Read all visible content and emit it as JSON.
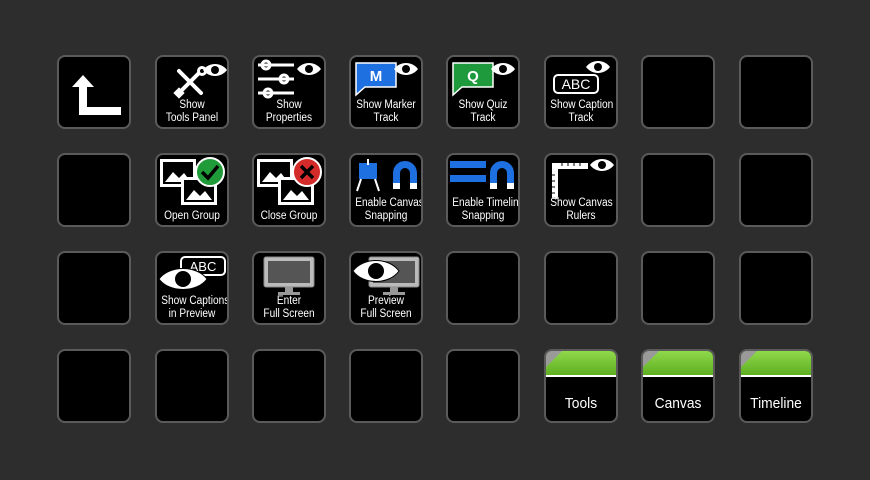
{
  "keys": {
    "back": {
      "icon": "back-arrow-icon"
    },
    "tools_panel": {
      "line1": "Show",
      "line2": "Tools Panel",
      "icon": "tools-icon"
    },
    "properties": {
      "line1": "Show",
      "line2": "Properties",
      "icon": "sliders-icon"
    },
    "marker_track": {
      "line1": "Show Marker",
      "line2": "Track",
      "badge": "M",
      "color": "#1e6fe0",
      "icon": "marker-icon"
    },
    "quiz_track": {
      "line1": "Show Quiz",
      "line2": "Track",
      "badge": "Q",
      "color": "#1e9a3c",
      "icon": "quiz-icon"
    },
    "caption_track": {
      "line1": "Show Caption",
      "line2": "Track",
      "badge": "ABC",
      "icon": "caption-icon"
    },
    "open_group": {
      "line1": "Open Group",
      "icon": "group-open-icon",
      "color": "#1f9b3a"
    },
    "close_group": {
      "line1": "Close Group",
      "icon": "group-close-icon",
      "color": "#d32a2a"
    },
    "canvas_snapping": {
      "line1": "Enable Canvas",
      "line2": "Snapping",
      "icon": "canvas-magnet-icon"
    },
    "timeline_snapping": {
      "line1": "Enable Timeline",
      "line2": "Snapping",
      "icon": "timeline-magnet-icon"
    },
    "canvas_rulers": {
      "line1": "Show Canvas",
      "line2": "Rulers",
      "icon": "ruler-icon"
    },
    "captions_preview": {
      "line1": "Show Captions",
      "line2": "in Preview",
      "badge": "ABC",
      "icon": "eye-caption-icon"
    },
    "full_screen": {
      "line1": "Enter",
      "line2": "Full Screen",
      "icon": "monitor-icon"
    },
    "preview_full_screen": {
      "line1": "Preview",
      "line2": "Full Screen",
      "icon": "monitor-eye-icon"
    },
    "tab_tools": {
      "label": "Tools"
    },
    "tab_canvas": {
      "label": "Canvas"
    },
    "tab_timeline": {
      "label": "Timeline"
    }
  },
  "colors": {
    "background": "#2d2d2d",
    "key": "#000000",
    "tab_green": "#7cc63a",
    "accent_blue": "#1e6fe0"
  }
}
